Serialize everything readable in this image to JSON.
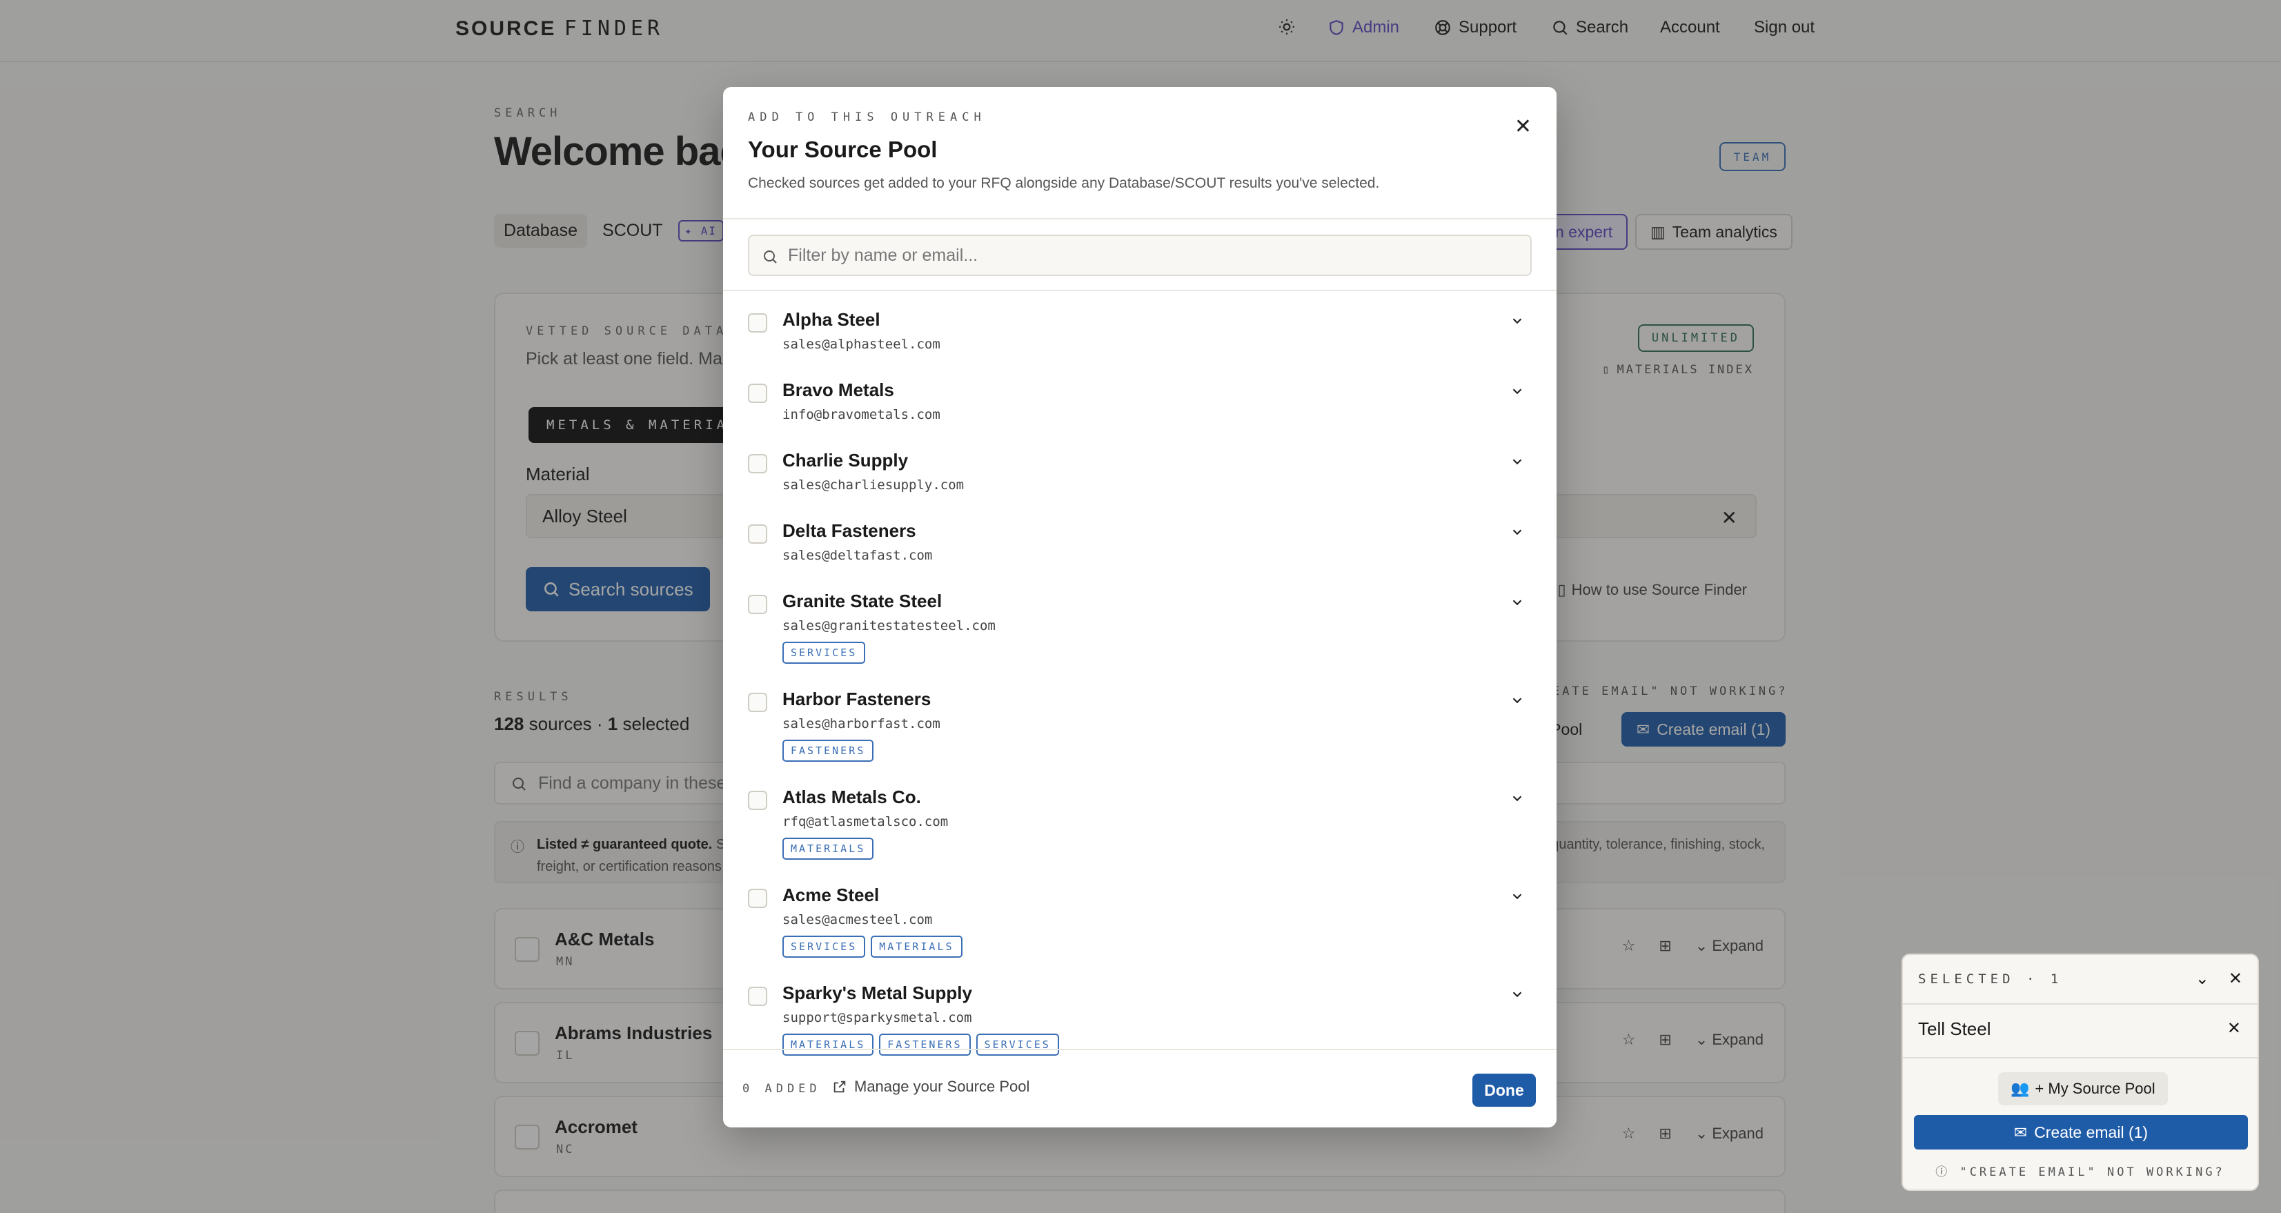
{
  "nav": {
    "brand_bold": "SOURCE",
    "brand_light": "FINDER",
    "admin": "Admin",
    "support": "Support",
    "search": "Search",
    "account": "Account",
    "sign_out": "Sign out"
  },
  "page": {
    "eyebrow": "SEARCH",
    "welcome": "Welcome back",
    "team_badge": "TEAM",
    "tabs": [
      "Database",
      "SCOUT"
    ],
    "ai_badge": "AI",
    "expert_btn": "n expert",
    "analytics_btn": "Team analytics",
    "card": {
      "eyebrow": "VETTED SOURCE DATAB",
      "sub": "Pick at least one field. Ma",
      "unlimited": "UNLIMITED",
      "materials_index": "MATERIALS INDEX",
      "metals_chip": "METALS & MATERIAL",
      "material_label": "Material",
      "material_value": "Alloy Steel",
      "search_btn": "Search sources",
      "howto": "How to use Source Finder"
    },
    "results": {
      "eyebrow": "RESULTS",
      "count": "128",
      "count_label": "sources ·",
      "selected": "1",
      "selected_label": "selected",
      "ce_note": "EATE EMAIL\" NOT WORKING?",
      "pool_btn": "e Pool",
      "create_email": "Create email (1)",
      "find_placeholder": "Find a company in these",
      "note_bold": "Listed ≠ guaranteed quote.",
      "note_rest": " Sc",
      "note_right": "quantity, tolerance, finishing, stock,",
      "note_line2": "freight, or certification reasons",
      "expand": "Expand",
      "rows": [
        {
          "name": "A&C Metals",
          "state": "MN"
        },
        {
          "name": "Abrams Industries",
          "state": "IL"
        },
        {
          "name": "Accromet",
          "state": "NC"
        }
      ]
    }
  },
  "tray": {
    "header": "SELECTED · 1",
    "item": "Tell Steel",
    "pool_btn": "+ My Source Pool",
    "create_email": "Create email (1)",
    "note": "\"CREATE EMAIL\" NOT WORKING?"
  },
  "modal": {
    "eyebrow": "ADD TO THIS OUTREACH",
    "title": "Your Source Pool",
    "description": "Checked sources get added to your RFQ alongside any Database/SCOUT results you've selected.",
    "filter_placeholder": "Filter by name or email...",
    "sources": [
      {
        "name": "Alpha Steel",
        "email": "sales@alphasteel.com",
        "tags": []
      },
      {
        "name": "Bravo Metals",
        "email": "info@bravometals.com",
        "tags": []
      },
      {
        "name": "Charlie Supply",
        "email": "sales@charliesupply.com",
        "tags": []
      },
      {
        "name": "Delta Fasteners",
        "email": "sales@deltafast.com",
        "tags": []
      },
      {
        "name": "Granite State Steel",
        "email": "sales@granitestatesteel.com",
        "tags": [
          "SERVICES"
        ]
      },
      {
        "name": "Harbor Fasteners",
        "email": "sales@harborfast.com",
        "tags": [
          "FASTENERS"
        ]
      },
      {
        "name": "Atlas Metals Co.",
        "email": "rfq@atlasmetalsco.com",
        "tags": [
          "MATERIALS"
        ]
      },
      {
        "name": "Acme Steel",
        "email": "sales@acmesteel.com",
        "tags": [
          "SERVICES",
          "MATERIALS"
        ]
      },
      {
        "name": "Sparky's Metal Supply",
        "email": "support@sparkysmetal.com",
        "tags": [
          "MATERIALS",
          "FASTENERS",
          "SERVICES"
        ]
      }
    ],
    "added": "0 ADDED",
    "manage": "Manage your Source Pool",
    "done": "Done"
  }
}
